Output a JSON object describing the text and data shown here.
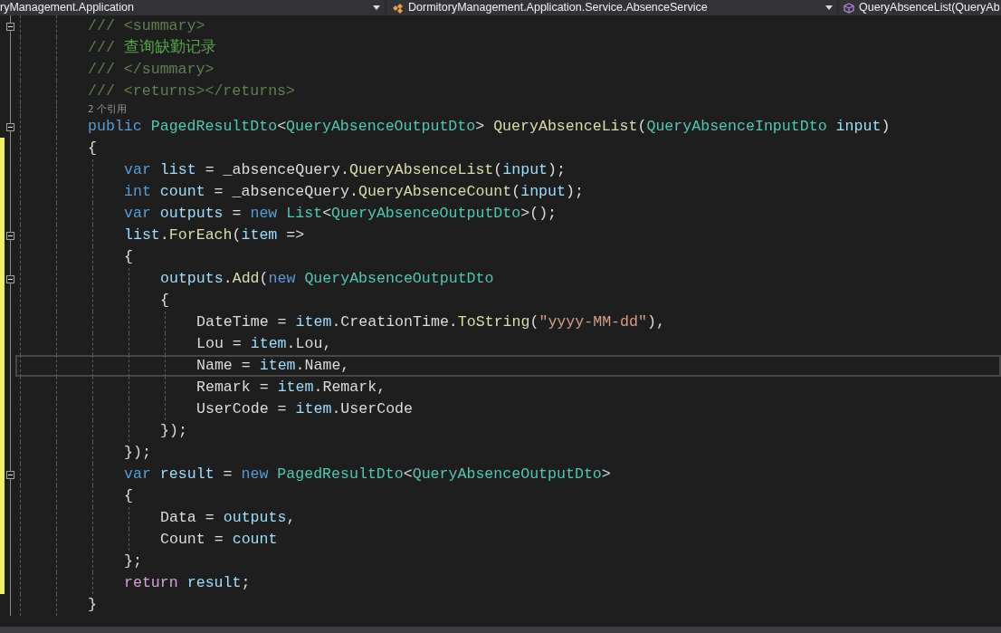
{
  "navigation_bar": [
    {
      "kind": "project",
      "text": "ryManagement.Application"
    },
    {
      "kind": "class",
      "text": "DormitoryManagement.Application.Service.AbsenceService"
    },
    {
      "kind": "member",
      "text": "QueryAbsenceList(QueryAb"
    }
  ],
  "code_lines": [
    {
      "kind": "code",
      "fold": true,
      "modified": false,
      "current": false,
      "tokens": [
        {
          "kind": "doc",
          "text": "/// <summary>"
        }
      ]
    },
    {
      "kind": "code",
      "fold": false,
      "modified": false,
      "current": false,
      "tokens": [
        {
          "kind": "doc",
          "text": "/// "
        },
        {
          "kind": "comment",
          "text": "查询缺勤记录"
        }
      ]
    },
    {
      "kind": "code",
      "fold": false,
      "modified": false,
      "current": false,
      "tokens": [
        {
          "kind": "doc",
          "text": "/// </summary>"
        }
      ]
    },
    {
      "kind": "code",
      "fold": false,
      "modified": false,
      "current": false,
      "tokens": [
        {
          "kind": "doc",
          "text": "/// <returns></returns>"
        }
      ]
    },
    {
      "kind": "codelens",
      "text": "2 个引用"
    },
    {
      "kind": "code",
      "fold": true,
      "modified": false,
      "current": false,
      "tokens": [
        {
          "kind": "keyword",
          "text": "public "
        },
        {
          "kind": "type",
          "text": "PagedResultDto"
        },
        {
          "kind": "plain",
          "text": "<"
        },
        {
          "kind": "type",
          "text": "QueryAbsenceOutputDto"
        },
        {
          "kind": "plain",
          "text": "> "
        },
        {
          "kind": "method",
          "text": "QueryAbsenceList"
        },
        {
          "kind": "plain",
          "text": "("
        },
        {
          "kind": "type",
          "text": "QueryAbsenceInputDto"
        },
        {
          "kind": "variable",
          "text": " input"
        },
        {
          "kind": "plain",
          "text": ")"
        }
      ]
    },
    {
      "kind": "code",
      "fold": false,
      "modified": true,
      "current": false,
      "tokens": [
        {
          "kind": "plain",
          "text": "{"
        }
      ],
      "children": [
        {
          "kind": "code",
          "fold": false,
          "modified": true,
          "current": false,
          "tokens": [
            {
              "kind": "keyword",
              "text": "var "
            },
            {
              "kind": "variable",
              "text": "list"
            },
            {
              "kind": "plain",
              "text": " = _absenceQuery."
            },
            {
              "kind": "method",
              "text": "QueryAbsenceList"
            },
            {
              "kind": "plain",
              "text": "("
            },
            {
              "kind": "variable",
              "text": "input"
            },
            {
              "kind": "plain",
              "text": ");"
            }
          ]
        },
        {
          "kind": "code",
          "fold": false,
          "modified": true,
          "current": false,
          "tokens": [
            {
              "kind": "keyword",
              "text": "int "
            },
            {
              "kind": "variable",
              "text": "count"
            },
            {
              "kind": "plain",
              "text": " = _absenceQuery."
            },
            {
              "kind": "method",
              "text": "QueryAbsenceCount"
            },
            {
              "kind": "plain",
              "text": "("
            },
            {
              "kind": "variable",
              "text": "input"
            },
            {
              "kind": "plain",
              "text": ");"
            }
          ]
        },
        {
          "kind": "code",
          "fold": false,
          "modified": true,
          "current": false,
          "tokens": [
            {
              "kind": "keyword",
              "text": "var "
            },
            {
              "kind": "variable",
              "text": "outputs"
            },
            {
              "kind": "plain",
              "text": " = "
            },
            {
              "kind": "keyword",
              "text": "new "
            },
            {
              "kind": "type",
              "text": "List"
            },
            {
              "kind": "plain",
              "text": "<"
            },
            {
              "kind": "type",
              "text": "QueryAbsenceOutputDto"
            },
            {
              "kind": "plain",
              "text": ">();"
            }
          ]
        },
        {
          "kind": "code",
          "fold": true,
          "modified": true,
          "current": false,
          "tokens": [
            {
              "kind": "variable",
              "text": "list"
            },
            {
              "kind": "plain",
              "text": "."
            },
            {
              "kind": "method",
              "text": "ForEach"
            },
            {
              "kind": "plain",
              "text": "("
            },
            {
              "kind": "variable",
              "text": "item"
            },
            {
              "kind": "plain",
              "text": " =>"
            }
          ]
        },
        {
          "kind": "code",
          "fold": false,
          "modified": true,
          "current": false,
          "tokens": [
            {
              "kind": "plain",
              "text": "{"
            }
          ],
          "children": [
            {
              "kind": "code",
              "fold": true,
              "modified": true,
              "current": false,
              "tokens": [
                {
                  "kind": "variable",
                  "text": "outputs"
                },
                {
                  "kind": "plain",
                  "text": "."
                },
                {
                  "kind": "method",
                  "text": "Add"
                },
                {
                  "kind": "plain",
                  "text": "("
                },
                {
                  "kind": "keyword",
                  "text": "new "
                },
                {
                  "kind": "type",
                  "text": "QueryAbsenceOutputDto"
                }
              ]
            },
            {
              "kind": "code",
              "fold": false,
              "modified": true,
              "current": false,
              "tokens": [
                {
                  "kind": "plain",
                  "text": "{"
                }
              ],
              "children": [
                {
                  "kind": "code",
                  "fold": false,
                  "modified": true,
                  "current": false,
                  "tokens": [
                    {
                      "kind": "plain",
                      "text": "DateTime = "
                    },
                    {
                      "kind": "variable",
                      "text": "item"
                    },
                    {
                      "kind": "plain",
                      "text": ".CreationTime."
                    },
                    {
                      "kind": "method",
                      "text": "ToString"
                    },
                    {
                      "kind": "plain",
                      "text": "("
                    },
                    {
                      "kind": "string",
                      "text": "\"yyyy-MM-dd\""
                    },
                    {
                      "kind": "plain",
                      "text": "),"
                    }
                  ]
                },
                {
                  "kind": "code",
                  "fold": false,
                  "modified": true,
                  "current": false,
                  "tokens": [
                    {
                      "kind": "plain",
                      "text": "Lou = "
                    },
                    {
                      "kind": "variable",
                      "text": "item"
                    },
                    {
                      "kind": "plain",
                      "text": ".Lou,"
                    }
                  ]
                },
                {
                  "kind": "code",
                  "fold": false,
                  "modified": true,
                  "current": true,
                  "tokens": [
                    {
                      "kind": "plain",
                      "text": "Name = "
                    },
                    {
                      "kind": "variable",
                      "text": "item"
                    },
                    {
                      "kind": "plain",
                      "text": ".Name,"
                    }
                  ]
                },
                {
                  "kind": "code",
                  "fold": false,
                  "modified": true,
                  "current": false,
                  "tokens": [
                    {
                      "kind": "plain",
                      "text": "Remark = "
                    },
                    {
                      "kind": "variable",
                      "text": "item"
                    },
                    {
                      "kind": "plain",
                      "text": ".Remark,"
                    }
                  ]
                },
                {
                  "kind": "code",
                  "fold": false,
                  "modified": true,
                  "current": false,
                  "tokens": [
                    {
                      "kind": "plain",
                      "text": "UserCode = "
                    },
                    {
                      "kind": "variable",
                      "text": "item"
                    },
                    {
                      "kind": "plain",
                      "text": ".UserCode"
                    }
                  ]
                }
              ]
            },
            {
              "kind": "code",
              "fold": false,
              "modified": true,
              "current": false,
              "tokens": [
                {
                  "kind": "plain",
                  "text": "});"
                }
              ]
            }
          ]
        },
        {
          "kind": "code",
          "fold": false,
          "modified": true,
          "current": false,
          "tokens": [
            {
              "kind": "plain",
              "text": "});"
            }
          ]
        },
        {
          "kind": "code",
          "fold": true,
          "modified": true,
          "current": false,
          "tokens": [
            {
              "kind": "keyword",
              "text": "var "
            },
            {
              "kind": "variable",
              "text": "result"
            },
            {
              "kind": "plain",
              "text": " = "
            },
            {
              "kind": "keyword",
              "text": "new "
            },
            {
              "kind": "type",
              "text": "PagedResultDto"
            },
            {
              "kind": "plain",
              "text": "<"
            },
            {
              "kind": "type",
              "text": "QueryAbsenceOutputDto"
            },
            {
              "kind": "plain",
              "text": ">"
            }
          ]
        },
        {
          "kind": "code",
          "fold": false,
          "modified": true,
          "current": false,
          "tokens": [
            {
              "kind": "plain",
              "text": "{"
            }
          ],
          "children": [
            {
              "kind": "code",
              "fold": false,
              "modified": true,
              "current": false,
              "tokens": [
                {
                  "kind": "plain",
                  "text": "Data = "
                },
                {
                  "kind": "variable",
                  "text": "outputs"
                },
                {
                  "kind": "plain",
                  "text": ","
                }
              ]
            },
            {
              "kind": "code",
              "fold": false,
              "modified": true,
              "current": false,
              "tokens": [
                {
                  "kind": "plain",
                  "text": "Count = "
                },
                {
                  "kind": "variable",
                  "text": "count"
                }
              ]
            }
          ]
        },
        {
          "kind": "code",
          "fold": false,
          "modified": true,
          "current": false,
          "tokens": [
            {
              "kind": "plain",
              "text": "};"
            }
          ]
        },
        {
          "kind": "code",
          "fold": false,
          "modified": true,
          "current": false,
          "tokens": [
            {
              "kind": "control",
              "text": "return "
            },
            {
              "kind": "variable",
              "text": "result"
            },
            {
              "kind": "plain",
              "text": ";"
            }
          ]
        }
      ]
    },
    {
      "kind": "code",
      "fold": false,
      "modified": false,
      "current": false,
      "tokens": [
        {
          "kind": "plain",
          "text": "}"
        }
      ]
    }
  ]
}
